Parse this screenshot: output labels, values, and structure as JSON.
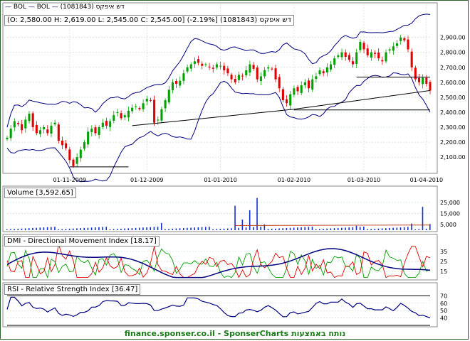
{
  "chart_data": {
    "type": "candlestick",
    "legend_items": [
      "BOL",
      "BOL",
      "(1081843) דש איפקס"
    ],
    "ohlc_label": "(O: 2,580.00  H: 2,619.00  L: 2,545.00  C: 2,545.00] (-2.19%] (1081843) דש איפקס",
    "price_ticks": [
      "2,900.00",
      "2,800.00",
      "2,700.00",
      "2,600.00",
      "2,500.00",
      "2,400.00",
      "2,300.00",
      "2,200.00",
      "2,100.00"
    ],
    "price_tick_values": [
      2900,
      2800,
      2700,
      2600,
      2500,
      2400,
      2300,
      2200,
      2100
    ],
    "date_ticks": [
      "01-11-2009",
      "01-12-2009",
      "01-01-2010",
      "01-02-2010",
      "01-03-2010",
      "01-04-2010"
    ],
    "ylim": [
      2020,
      2960
    ],
    "close_series": [
      2230,
      2290,
      2340,
      2320,
      2280,
      2350,
      2390,
      2300,
      2260,
      2280,
      2300,
      2260,
      2310,
      2330,
      2210,
      2180,
      2160,
      2080,
      2040,
      2100,
      2150,
      2200,
      2270,
      2290,
      2260,
      2300,
      2330,
      2310,
      2340,
      2380,
      2400,
      2360,
      2380,
      2410,
      2430,
      2440,
      2420,
      2460,
      2490,
      2480,
      2330,
      2350,
      2420,
      2480,
      2550,
      2600,
      2590,
      2610,
      2660,
      2700,
      2720,
      2740,
      2730,
      2710,
      2720,
      2700,
      2690,
      2720,
      2710,
      2680,
      2660,
      2620,
      2600,
      2650,
      2640,
      2680,
      2720,
      2690,
      2620,
      2640,
      2680,
      2700,
      2690,
      2620,
      2560,
      2480,
      2460,
      2520,
      2560,
      2540,
      2580,
      2600,
      2560,
      2620,
      2640,
      2680,
      2660,
      2700,
      2720,
      2760,
      2780,
      2800,
      2770,
      2750,
      2720,
      2800,
      2870,
      2820,
      2780,
      2800,
      2790,
      2760,
      2740,
      2800,
      2820,
      2840,
      2860,
      2900,
      2880,
      2820,
      2700,
      2620,
      2600,
      2630,
      2590,
      2545
    ],
    "volume_panel": {
      "label": "Volume [3,592.65]",
      "ticks": [
        "25,000",
        "15,000",
        "5,000"
      ],
      "tick_values": [
        25000,
        15000,
        5000
      ],
      "ylim": [
        0,
        32000
      ]
    },
    "dmi_panel": {
      "label": "DMI - Directional Movement Index [18.17]",
      "ticks": [
        "35",
        "25",
        "15"
      ],
      "tick_values": [
        35,
        25,
        15
      ],
      "ylim": [
        8,
        45
      ]
    },
    "rsi_panel": {
      "label": "RSI - Relative Strength Index [36.47]",
      "ticks": [
        "70",
        "60",
        "50",
        "40"
      ],
      "tick_values": [
        70,
        60,
        50,
        40
      ],
      "ylim": [
        30,
        78
      ],
      "levels": [
        70,
        30
      ]
    }
  },
  "footer": {
    "text": "finance.sponser.co.il - SponserCharts נותח באמצעות"
  },
  "colors": {
    "up": "#00a000",
    "down": "#e00000",
    "band": "#000080",
    "volume": "#1030d0",
    "dmi_plus": "#00a000",
    "dmi_minus": "#e00000",
    "adx": "#000080",
    "rsi": "#000080",
    "frame": "#2a5f2a",
    "footer": "#1a7a1a"
  }
}
